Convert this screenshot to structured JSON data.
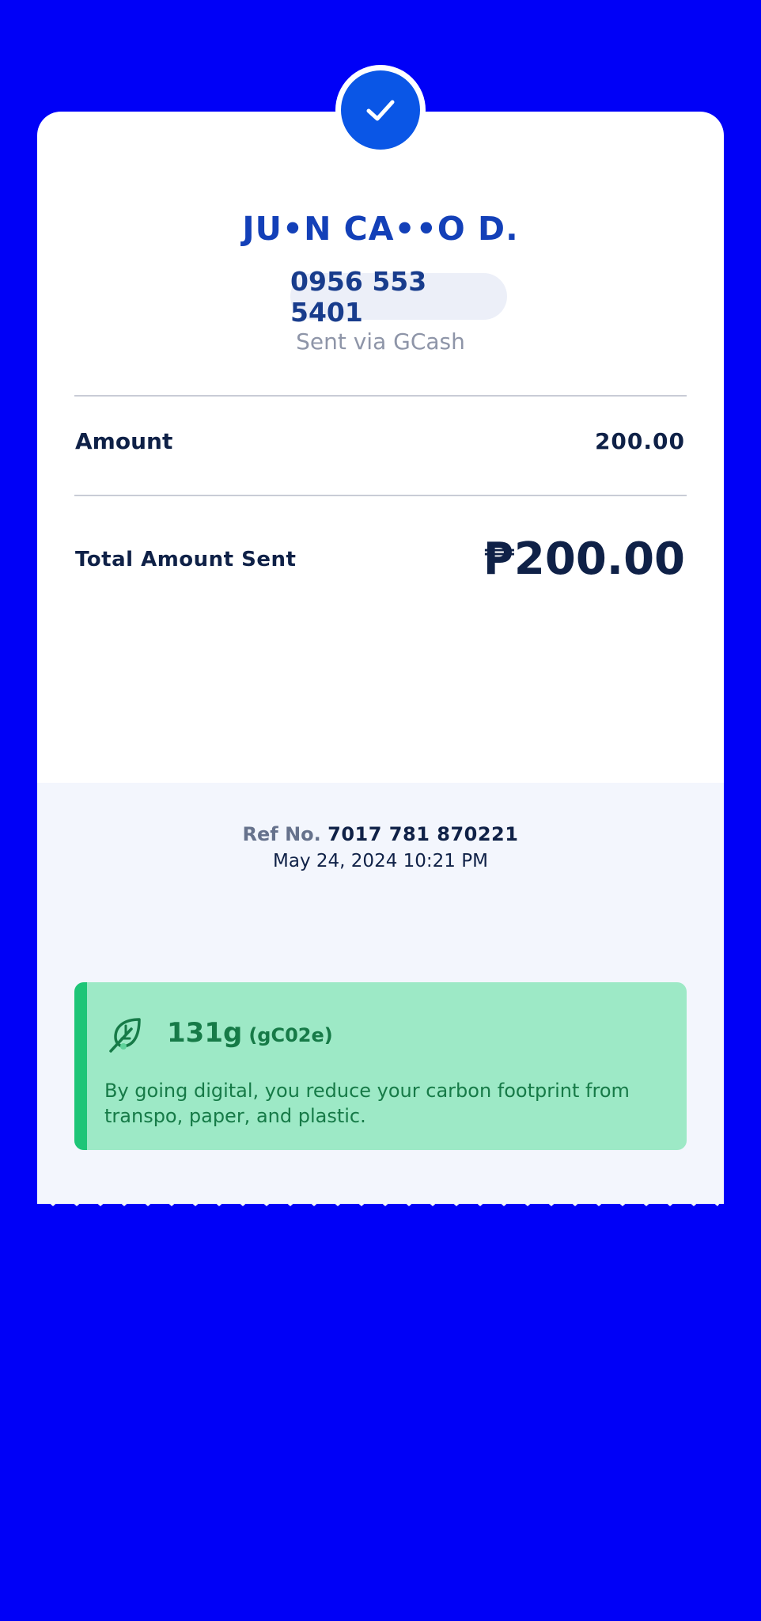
{
  "colors": {
    "background": "#0000F7",
    "accent": "#0A56E6",
    "name": "#1340B8",
    "text_dark": "#0F2147",
    "eco_bg": "#9DE9C6",
    "eco_accent": "#1EC577",
    "eco_text": "#167A47"
  },
  "recipient": {
    "name": "JU•N CA••O D.",
    "phone": "0956 553 5401",
    "method": "Sent via GCash"
  },
  "amount": {
    "label": "Amount",
    "value": "200.00"
  },
  "total": {
    "label": "Total Amount Sent",
    "value": "₱200.00"
  },
  "reference": {
    "label": "Ref No.",
    "number": "7017 781 870221",
    "datetime": "May 24, 2024 10:21 PM"
  },
  "eco": {
    "icon": "leaf-icon",
    "amount": "131g",
    "unit": "(gC02e)",
    "message": "By going digital, you reduce your carbon footprint from transpo, paper, and plastic."
  }
}
